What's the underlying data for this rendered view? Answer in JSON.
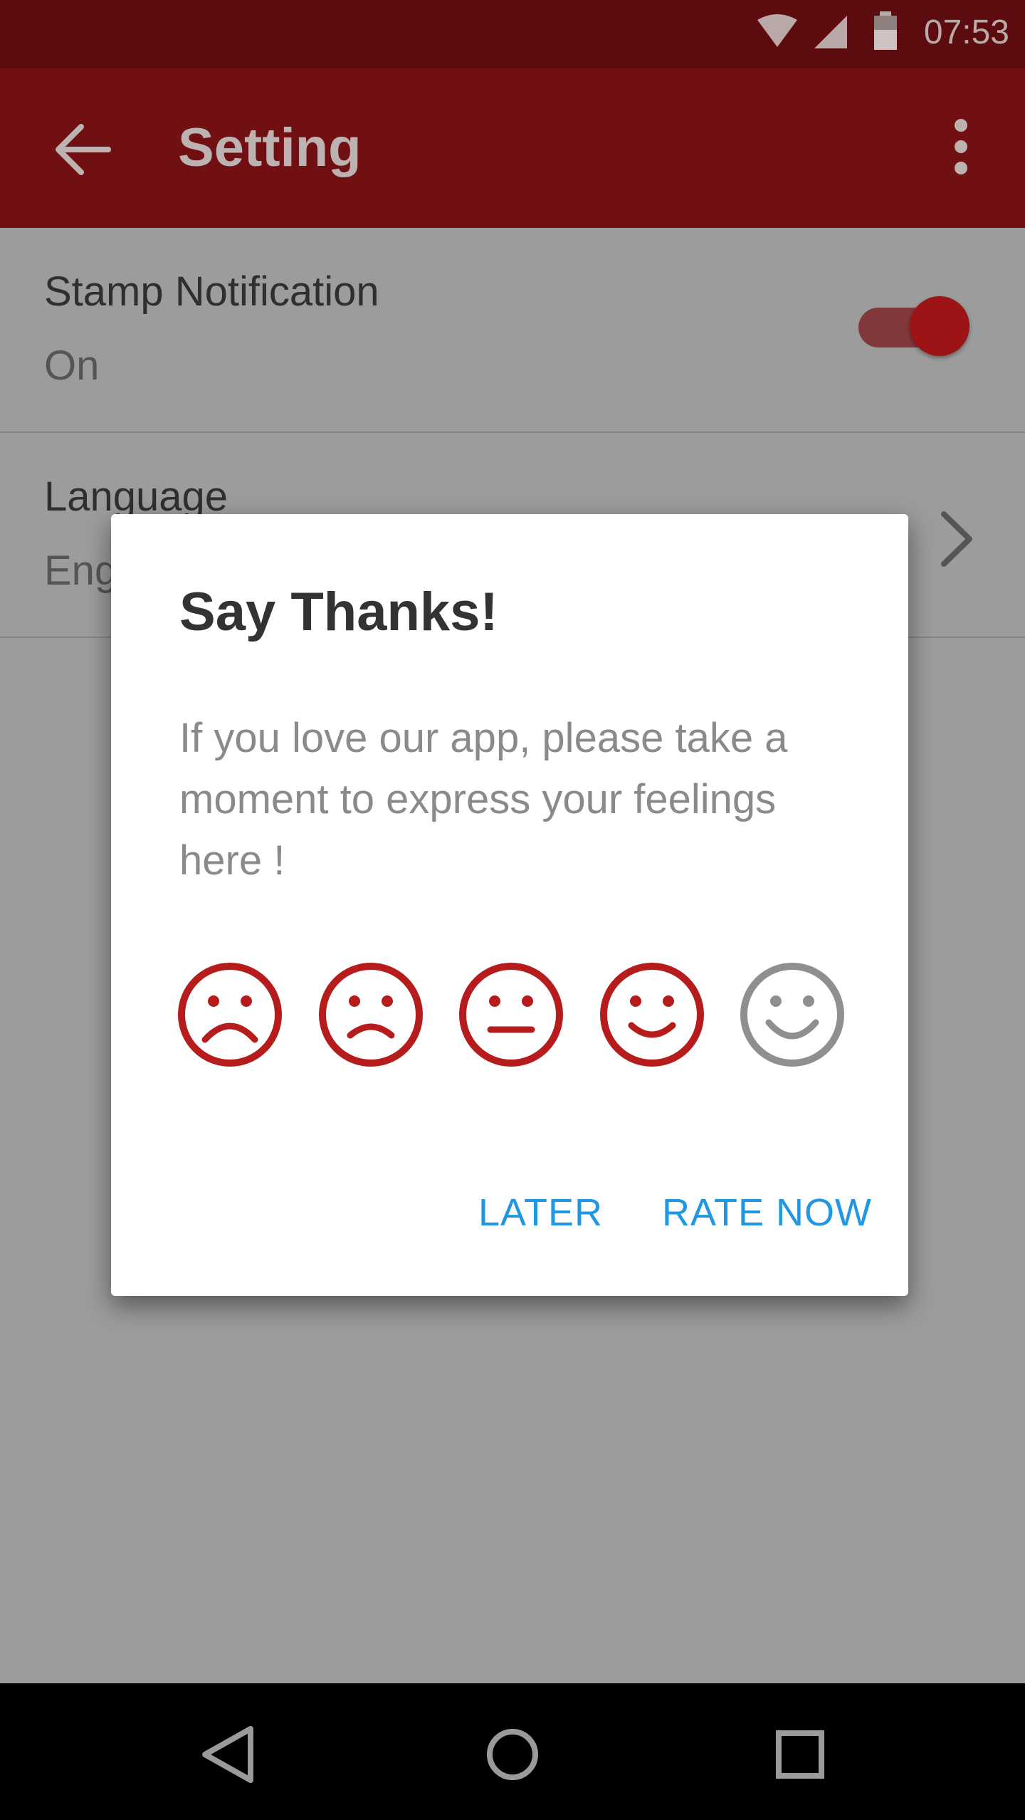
{
  "status_bar": {
    "time": "07:53",
    "icons": [
      "wifi-icon",
      "signal-icon",
      "battery-icon"
    ]
  },
  "app_bar": {
    "title": "Setting",
    "back_icon": "arrow-back-icon",
    "menu_icon": "more-vert-icon"
  },
  "settings": {
    "stamp_notification": {
      "label": "Stamp Notification",
      "value": "On",
      "enabled": true
    },
    "language": {
      "label": "Language",
      "value": "Eng"
    }
  },
  "dialog": {
    "title": "Say Thanks!",
    "message": "If you love our app, please take a moment to express your feelings here !",
    "ratings": [
      "very-sad-face-icon",
      "sad-face-icon",
      "neutral-face-icon",
      "happy-face-icon",
      "very-happy-face-icon"
    ],
    "later_label": "LATER",
    "rate_now_label": "RATE NOW"
  },
  "colors": {
    "status_bar": "#5c0b0e",
    "app_bar": "#701013",
    "accent_red": "#b71c1c",
    "face_inactive": "#8f8f8f",
    "button_blue": "#2196e3"
  },
  "nav_bar": {
    "icons": [
      "back-triangle-icon",
      "home-circle-icon",
      "recents-square-icon"
    ]
  }
}
